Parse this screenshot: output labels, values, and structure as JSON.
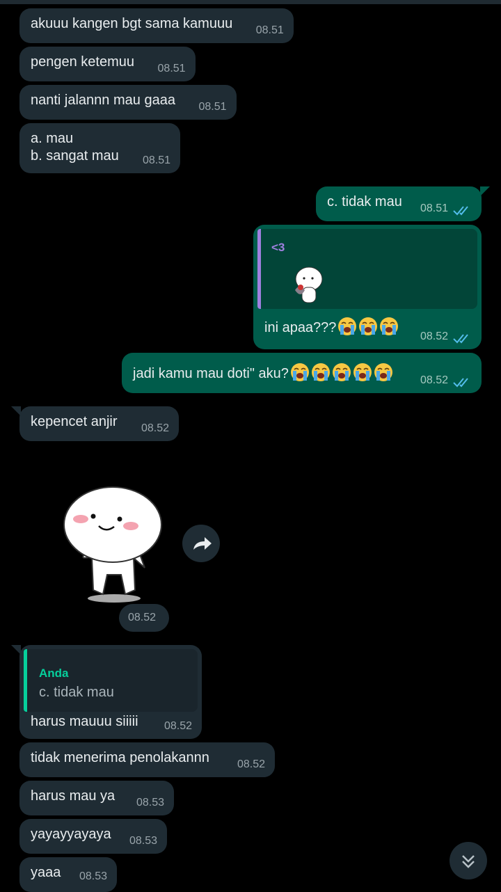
{
  "messages": [
    {
      "text": "akuuu kangen bgt sama kamuuu",
      "time": "08.51"
    },
    {
      "text": "pengen ketemuu",
      "time": "08.51"
    },
    {
      "text": "nanti jalannn mau gaaa",
      "time": "08.51"
    },
    {
      "text": "a. mau\nb. sangat mau",
      "time": "08.51"
    },
    {
      "text": "c. tidak mau",
      "time": "08.51"
    },
    {
      "quote_author": "<3",
      "text": "ini apaa???",
      "time": "08.52"
    },
    {
      "text": "jadi kamu mau doti\" aku?",
      "time": "08.52"
    },
    {
      "text": "kepencet anjir",
      "time": "08.52"
    },
    {
      "sticker": "smiling-mochi-sticker",
      "time": "08.52"
    },
    {
      "quote_author": "Anda",
      "quote_text": "c. tidak mau",
      "text": "harus mauuu siiiii",
      "time": "08.52"
    },
    {
      "text": "tidak menerima penolakannn",
      "time": "08.52"
    },
    {
      "text": "harus mau ya",
      "time": "08.53"
    },
    {
      "text": "yayayyayaya",
      "time": "08.53"
    },
    {
      "text": "yaaa",
      "time": "08.53"
    }
  ],
  "icons": {
    "read_receipt": "double-check-icon",
    "crying_emoji": "loudly-crying-face-icon",
    "forward": "forward-icon",
    "scroll_down": "double-chevron-down-icon"
  },
  "colors": {
    "incoming_bubble": "#1f2c34",
    "outgoing_bubble": "#005c4b",
    "read_tick": "#53bdeb",
    "quote_own": "#06cf9c",
    "quote_other": "#a080e0"
  }
}
